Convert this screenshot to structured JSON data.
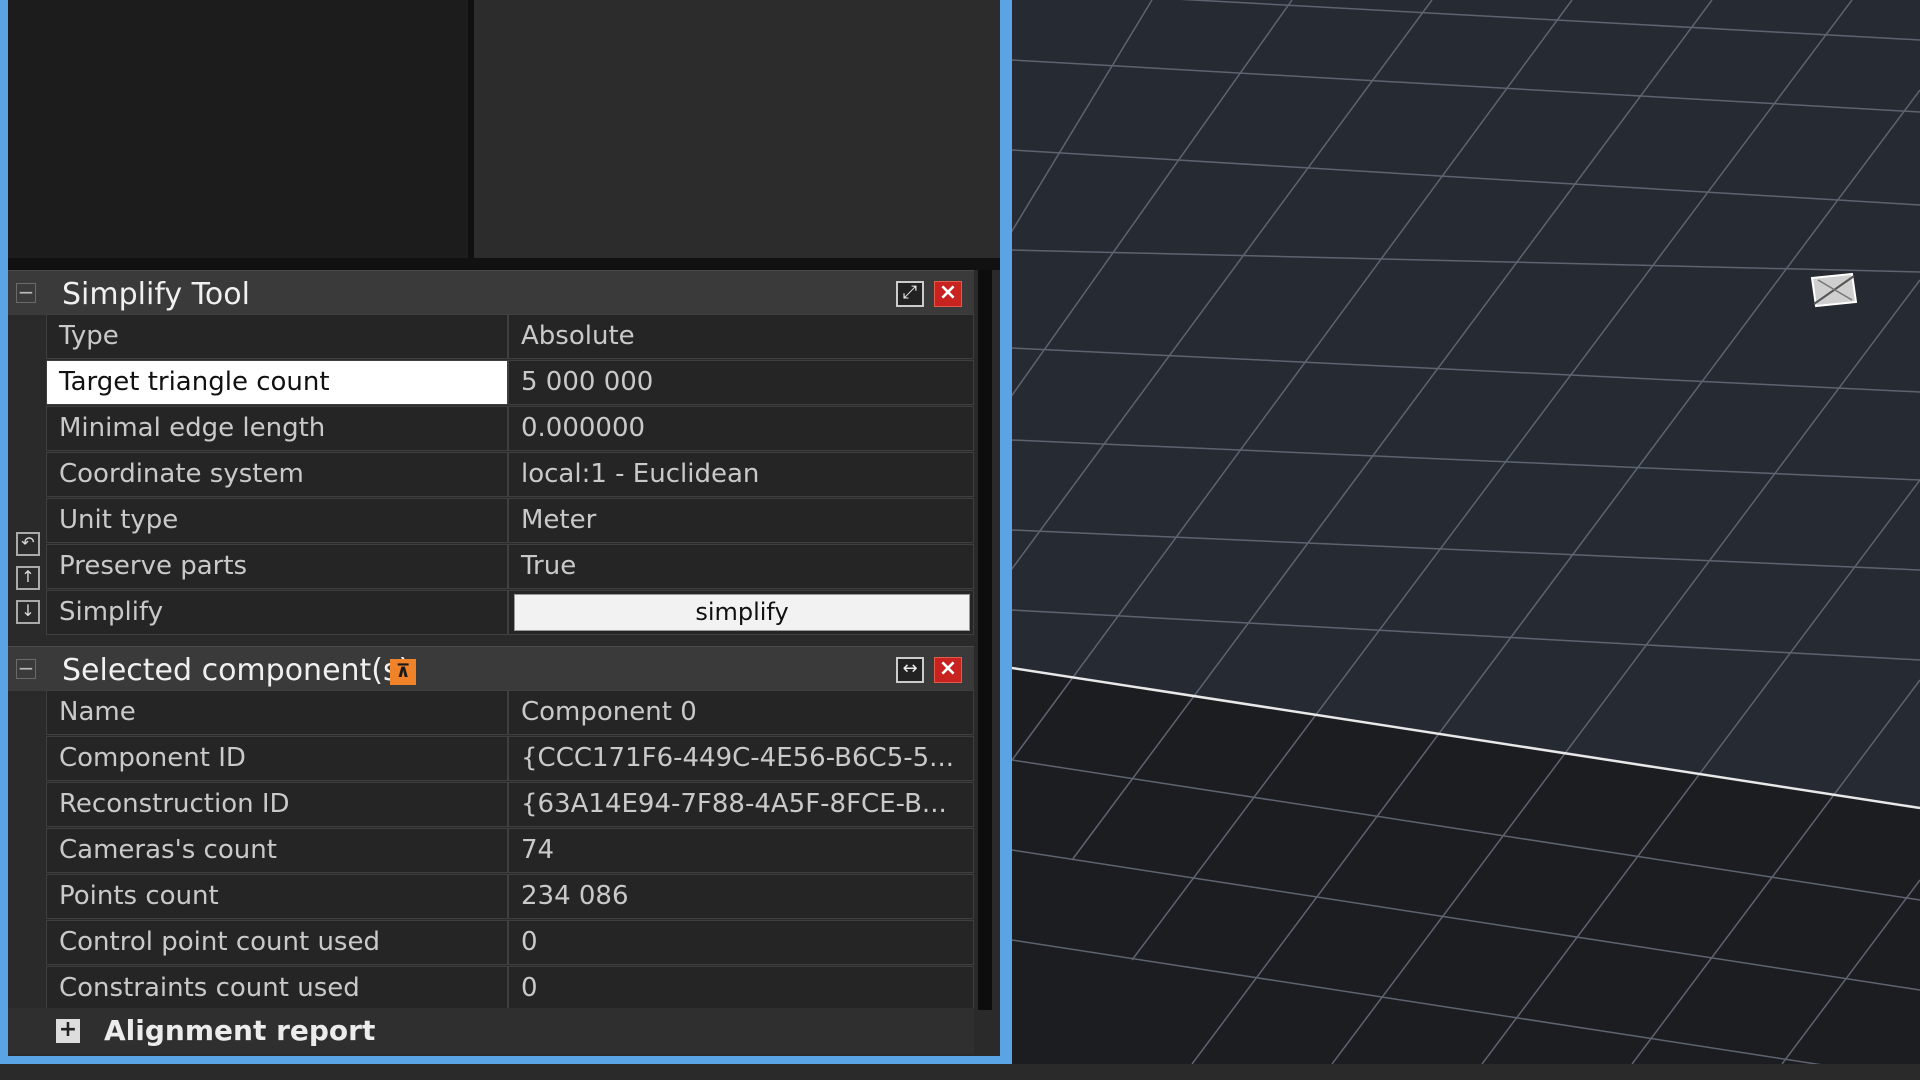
{
  "simplify_tool": {
    "title": "Simplify Tool",
    "rows": [
      {
        "label": "Type",
        "value": "Absolute"
      },
      {
        "label": "Target triangle count",
        "value": "5 000 000"
      },
      {
        "label": "Minimal edge length",
        "value": "0.000000"
      },
      {
        "label": "Coordinate system",
        "value": "local:1 - Euclidean"
      },
      {
        "label": "Unit type",
        "value": "Meter"
      },
      {
        "label": "Preserve parts",
        "value": "True"
      },
      {
        "label": "Simplify",
        "button": "simplify"
      }
    ]
  },
  "selected_components": {
    "title": "Selected component(s)",
    "rows": [
      {
        "label": "Name",
        "value": "Component 0"
      },
      {
        "label": "Component ID",
        "value": "{CCC171F6-449C-4E56-B6C5-5..."
      },
      {
        "label": "Reconstruction ID",
        "value": "{63A14E94-7F88-4A5F-8FCE-B..."
      },
      {
        "label": "Cameras's count",
        "value": "74"
      },
      {
        "label": "Points count",
        "value": "234 086"
      },
      {
        "label": "Control point count used",
        "value": "0"
      },
      {
        "label": "Constraints count used",
        "value": "0"
      }
    ]
  },
  "alignment_report": {
    "label": "Alignment report"
  },
  "icons": {
    "collapse": "minus-icon",
    "dock": "dock-icon",
    "close": "close-icon",
    "pin": "pin-icon",
    "expand": "plus-icon"
  },
  "colors": {
    "accent_blue": "#5aa4e6",
    "close_red": "#c8231f",
    "pin_orange": "#f0832a"
  }
}
